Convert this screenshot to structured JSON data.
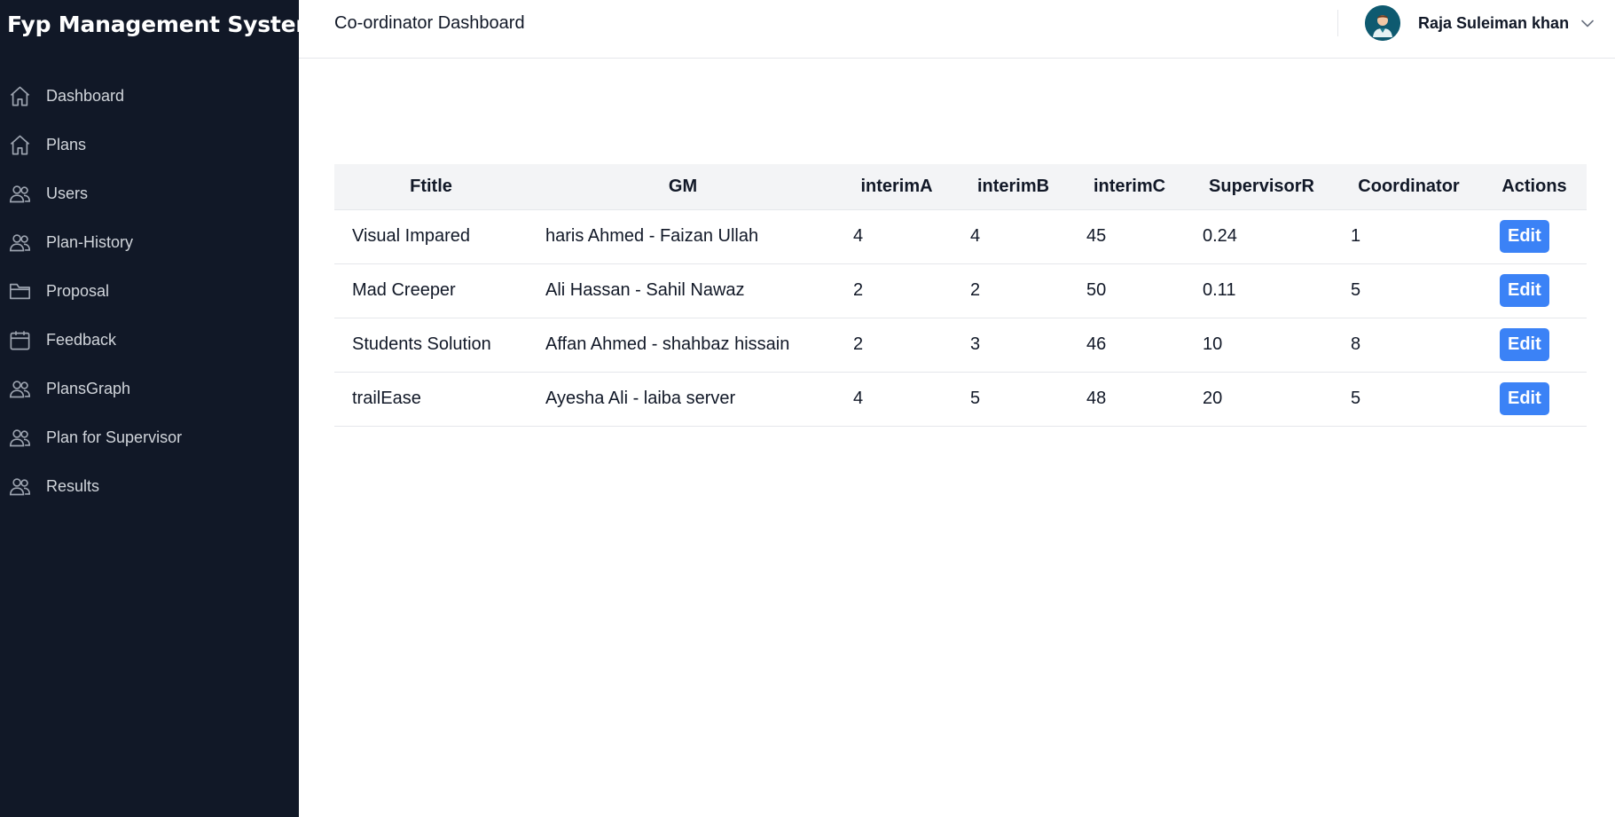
{
  "app": {
    "title": "Fyp Management System"
  },
  "sidebar": {
    "items": [
      {
        "label": "Dashboard",
        "icon": "home-icon"
      },
      {
        "label": "Plans",
        "icon": "home-icon"
      },
      {
        "label": "Users",
        "icon": "users-icon"
      },
      {
        "label": "Plan-History",
        "icon": "users-icon"
      },
      {
        "label": "Proposal",
        "icon": "folder-icon"
      },
      {
        "label": "Feedback",
        "icon": "calendar-icon"
      },
      {
        "label": "PlansGraph",
        "icon": "users-icon"
      },
      {
        "label": "Plan for Supervisor",
        "icon": "users-icon"
      },
      {
        "label": "Results",
        "icon": "users-icon"
      }
    ]
  },
  "header": {
    "title": "Co-ordinator Dashboard",
    "user_name": "Raja Suleiman khan"
  },
  "table": {
    "columns": [
      "Ftitle",
      "GM",
      "interimA",
      "interimB",
      "interimC",
      "SupervisorR",
      "Coordinator",
      "Actions"
    ],
    "rows": [
      {
        "ftitle": "Visual Impared",
        "gm": "haris Ahmed - Faizan Ullah",
        "interimA": "4",
        "interimB": "4",
        "interimC": "45",
        "supervisorR": "0.24",
        "coordinator": "1",
        "action": "Edit"
      },
      {
        "ftitle": "Mad Creeper",
        "gm": "Ali Hassan - Sahil Nawaz",
        "interimA": "2",
        "interimB": "2",
        "interimC": "50",
        "supervisorR": "0.11",
        "coordinator": "5",
        "action": "Edit"
      },
      {
        "ftitle": "Students Solution",
        "gm": "Affan Ahmed - shahbaz hissain",
        "interimA": "2",
        "interimB": "3",
        "interimC": "46",
        "supervisorR": "10",
        "coordinator": "8",
        "action": "Edit"
      },
      {
        "ftitle": "trailEase",
        "gm": "Ayesha Ali - laiba server",
        "interimA": "4",
        "interimB": "5",
        "interimC": "48",
        "supervisorR": "20",
        "coordinator": "5",
        "action": "Edit"
      }
    ]
  },
  "colors": {
    "sidebar_bg": "#111827",
    "accent": "#3b82f6",
    "header_row_bg": "#f3f4f6"
  }
}
